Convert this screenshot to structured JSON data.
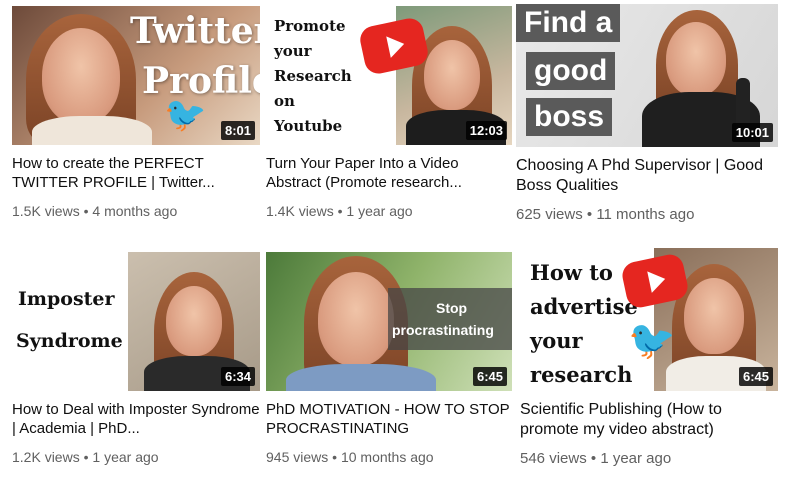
{
  "videos": [
    {
      "title": "How to create the PERFECT TWITTER PROFILE | Twitter...",
      "views": "1.5K views",
      "age": "4 months ago",
      "duration": "8:01",
      "overlay": [
        "Twitter",
        "Profile"
      ]
    },
    {
      "title": "Turn Your Paper Into a Video Abstract (Promote research...",
      "views": "1.4K views",
      "age": "1 year ago",
      "duration": "12:03",
      "overlay": [
        "Promote",
        "your",
        "Research",
        "on",
        "Youtube"
      ]
    },
    {
      "title": "Choosing A Phd Supervisor | Good Boss Qualities",
      "views": "625 views",
      "age": "11 months ago",
      "duration": "10:01",
      "overlay": [
        "Find a",
        "good",
        "boss"
      ]
    },
    {
      "title": "How to Deal with Imposter Syndrome | Academia | PhD...",
      "views": "1.2K views",
      "age": "1 year ago",
      "duration": "6:34",
      "overlay": [
        "Imposter",
        "Syndrome"
      ]
    },
    {
      "title": "PhD MOTIVATION - HOW TO STOP PROCRASTINATING",
      "views": "945 views",
      "age": "10 months ago",
      "duration": "6:45",
      "overlay": [
        "Stop",
        "procrastinating"
      ]
    },
    {
      "title": "Scientific Publishing (How to promote my video abstract)",
      "views": "546 views",
      "age": "1 year ago",
      "duration": "6:45",
      "overlay": [
        "How to",
        "advertise",
        "your",
        "research"
      ]
    }
  ],
  "separator": "•",
  "icons": {
    "play": "youtube-play-icon",
    "bird": "twitter-bird-icon"
  },
  "colors": {
    "youtube_red": "#e52620",
    "twitter_blue": "#1da1f2"
  }
}
